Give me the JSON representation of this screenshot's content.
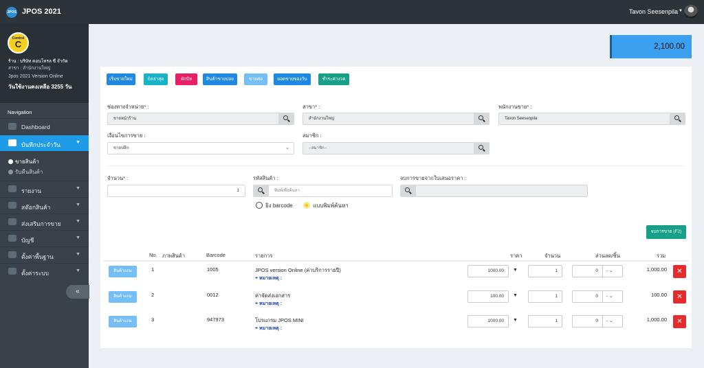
{
  "topbar": {
    "logo_text": "JPOS",
    "app_title": "JPOS 2021",
    "user_name": "Tavon Seesenpila"
  },
  "sidebar": {
    "logo_small": "Control",
    "logo_big": "C",
    "shop": "ร้าน : บริษัท คอนโทรล ซี จำกัด",
    "branch": "สาขา : สำนักงานใหญ่",
    "version": "Jpos 2021 Version Online",
    "days_left": "วันใช้งานคงเหลือ 3255 วัน",
    "nav_title": "Navigation",
    "items": [
      {
        "label": "Dashboard"
      },
      {
        "label": "บันทึกประจำวัน"
      },
      {
        "label": "รายงาน"
      },
      {
        "label": "สต๊อกสินค้า"
      },
      {
        "label": "ส่งเสริมการขาย"
      },
      {
        "label": "บัญชี"
      },
      {
        "label": "ตั้งค่าพื้นฐาน"
      },
      {
        "label": "ตั้งค่าระบบ"
      }
    ],
    "sub_items": [
      {
        "label": "ขายสินค้า"
      },
      {
        "label": "รับคืนสินค้า"
      }
    ],
    "collapse_label": "«"
  },
  "total": "2,100.00",
  "toolbar": {
    "buttons": [
      {
        "label": "เริ่มขายใหม่",
        "color": "#1e88e5"
      },
      {
        "label": "บิลล่าสุด",
        "color": "#17b3c8"
      },
      {
        "label": "พักบิล",
        "color": "#e91e63"
      },
      {
        "label": "สินค้าขายบ่อย",
        "color": "#1e88e5"
      },
      {
        "label": "ขายต่อ",
        "color": "#75bff6"
      },
      {
        "label": "ยอดขายของวัน",
        "color": "#1e88e5"
      },
      {
        "label": "ชำระค่างวด",
        "color": "#16a087"
      }
    ]
  },
  "form": {
    "channel_label": "ช่องทางจำหน่าย* :",
    "channel_value": "ขายหน้าร้าน",
    "branch_label": "สาขา* :",
    "branch_value": "สำนักงานใหญ่",
    "staff_label": "พนักงานขาย* :",
    "staff_value": "Tavon Seesenpila",
    "condition_label": "เงื่อนไขการขาย :",
    "condition_value": "ขายปลีก",
    "member_label": "สมาชิก :",
    "member_placeholder": "--สมาชิก--",
    "qty_label": "จำนวน* :",
    "qty_value": "1",
    "code_label": "รหัสสินค้า :",
    "code_placeholder": "พิมพ์เพื่อค้นหา",
    "quote_label": "จบการขายจากใบเสนอราคา :",
    "radio_barcode": "ยิง barcode",
    "radio_search": "แบบพิมพ์ค้นหา",
    "end_sale_button": "จบการขาย (F2)"
  },
  "table": {
    "headers": {
      "no": "No.",
      "image": "ภาพสินค้า",
      "barcode": "Barcode",
      "item": "รายการ",
      "price": "ราคา",
      "qty": "จำนวน",
      "discount": "ส่วนลด/ชิ้น",
      "total": "รวม"
    },
    "detail_button": "สินค้าแถม",
    "note_label": "+ หมายเหตุ :",
    "discount_unit": "-",
    "rows": [
      {
        "no": "1",
        "barcode": "1005",
        "item": "JPOS version Online (ค่าบริการรายปี)",
        "price": "1000.00",
        "qty": "1",
        "discount": "0",
        "total": "1,000.00"
      },
      {
        "no": "2",
        "barcode": "0012",
        "item": "ค่าจัดส่งเอกสาร",
        "price": "100.00",
        "qty": "1",
        "discount": "0",
        "total": "100.00"
      },
      {
        "no": "3",
        "barcode": "947973",
        "item": "โปรแกรม JPOS MINI",
        "price": "1000.00",
        "qty": "1",
        "discount": "0",
        "total": "1,000.00"
      }
    ]
  }
}
